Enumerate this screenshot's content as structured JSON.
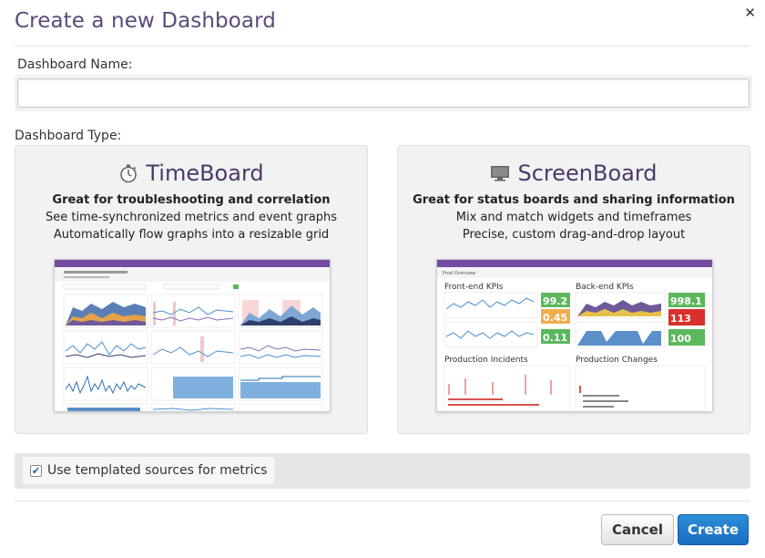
{
  "dialog": {
    "title": "Create a new Dashboard",
    "close_glyph": "✕"
  },
  "name_field": {
    "label": "Dashboard Name:",
    "value": "",
    "placeholder": ""
  },
  "type_section": {
    "label": "Dashboard Type:",
    "options": [
      {
        "icon": "stopwatch-icon",
        "title": "TimeBoard",
        "subtitle": "Great for troubleshooting and correlation",
        "line1": "See time-synchronized metrics and event graphs",
        "line2": "Automatically flow graphs into a resizable grid"
      },
      {
        "icon": "monitor-icon",
        "title": "ScreenBoard",
        "subtitle": "Great for status boards and sharing information",
        "line1": "Mix and match widgets and timeframes",
        "line2": "Precise, custom drag-and-drop layout"
      }
    ]
  },
  "screenboard_preview": {
    "tab": "Prod Overview",
    "frontend_title": "Front-end KPIs",
    "backend_title": "Back-end KPIs",
    "incidents_title": "Production Incidents",
    "changes_title": "Production Changes",
    "values": [
      "99.2",
      "0.45",
      "0.11",
      "998.1",
      "113",
      "100"
    ]
  },
  "templated": {
    "checked": true,
    "label": "Use templated sources for metrics"
  },
  "buttons": {
    "cancel": "Cancel",
    "create": "Create"
  },
  "colors": {
    "title": "#5a4a7a",
    "brand_purple": "#774aa4",
    "primary_blue": "#1a6cc0",
    "value_green": "#5cb85c",
    "value_red": "#d9302c"
  }
}
